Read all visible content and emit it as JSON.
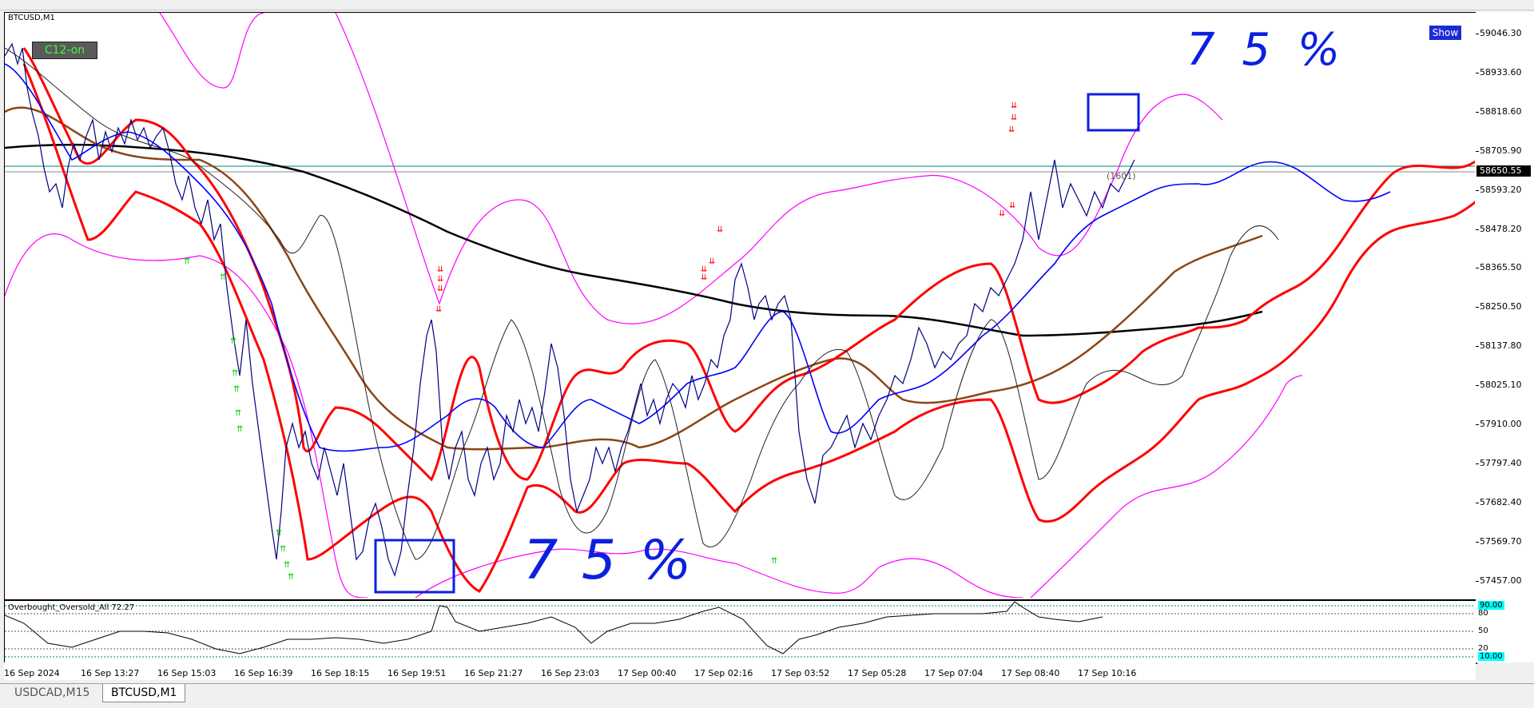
{
  "window": {
    "symbol_title": "BTCUSD,M1"
  },
  "chart": {
    "c12_button": "C12-on",
    "show_button": "Show",
    "current_price": "58650.55",
    "line_price": "58666.55",
    "order_label": "(1601)",
    "annotation_top": "7 5 %",
    "annotation_bottom": "7 5 %",
    "price_scale": [
      "59046.30",
      "58933.60",
      "58818.60",
      "58705.90",
      "58593.20",
      "58478.20",
      "58365.50",
      "58250.50",
      "58137.80",
      "58025.10",
      "57910.00",
      "57797.40",
      "57682.40",
      "57569.70",
      "57457.00"
    ],
    "time_labels": [
      "16 Sep 2024",
      "16 Sep 13:27",
      "16 Sep 15:03",
      "16 Sep 16:39",
      "16 Sep 18:15",
      "16 Sep 19:51",
      "16 Sep 21:27",
      "16 Sep 23:03",
      "17 Sep 00:40",
      "17 Sep 02:16",
      "17 Sep 03:52",
      "17 Sep 05:28",
      "17 Sep 07:04",
      "17 Sep 08:40",
      "17 Sep 10:16"
    ]
  },
  "indicator": {
    "label": "Overbought_Oversold_All 72.27",
    "levels": [
      "90.00",
      "80",
      "50",
      "20",
      "10.00"
    ]
  },
  "tabs": [
    {
      "label": "USDCAD,M15",
      "active": false
    },
    {
      "label": "BTCUSD,M1",
      "active": true
    }
  ],
  "colors": {
    "bollinger_red": "#ff0000",
    "bollinger_outer": "#ff00ff",
    "ma_black": "#000000",
    "ma_brown": "#8b4513",
    "ma_blue": "#0000ff",
    "price_line": "#000080",
    "annotation_blue": "#0b1fe0",
    "arrow_up": "#00ff00",
    "arrow_down": "#ff0000"
  }
}
